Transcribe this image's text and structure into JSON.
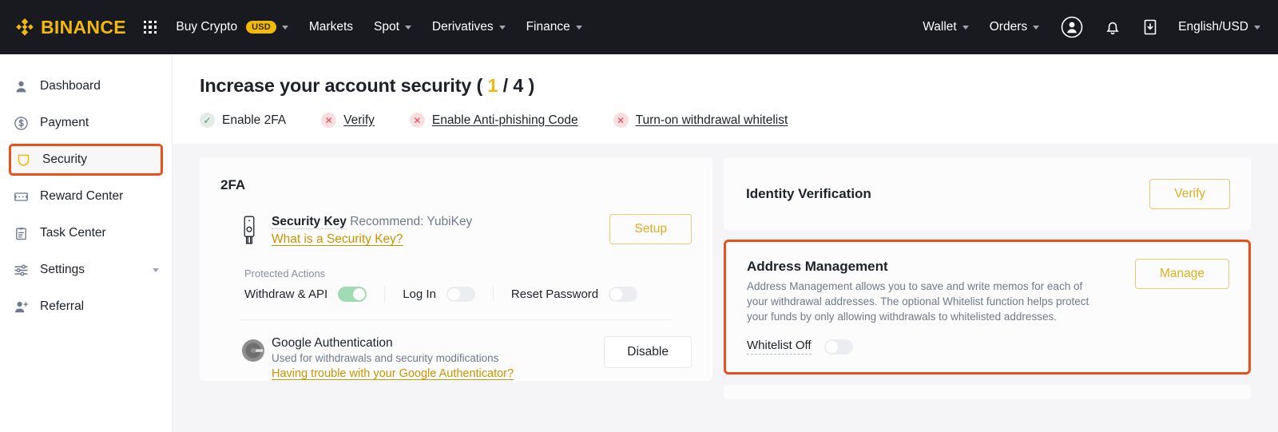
{
  "topnav": {
    "brand": "BINANCE",
    "apps_icon": "grid-apps-icon",
    "items": [
      {
        "label": "Buy Crypto",
        "badge": "USD",
        "caret": true
      },
      {
        "label": "Markets",
        "badge": null,
        "caret": false
      },
      {
        "label": "Spot",
        "badge": null,
        "caret": true
      },
      {
        "label": "Derivatives",
        "badge": null,
        "caret": true
      },
      {
        "label": "Finance",
        "badge": null,
        "caret": true
      }
    ],
    "right_items": [
      {
        "label": "Wallet",
        "caret": true
      },
      {
        "label": "Orders",
        "caret": true
      }
    ],
    "icons": [
      "user-account-icon",
      "notification-bell-icon",
      "download-app-icon"
    ],
    "locale": "English/USD"
  },
  "sidebar": {
    "items": [
      {
        "label": "Dashboard",
        "icon": "user-icon",
        "active": false,
        "caret": false
      },
      {
        "label": "Payment",
        "icon": "dollar-circle-icon",
        "active": false,
        "caret": false
      },
      {
        "label": "Security",
        "icon": "shield-icon",
        "active": true,
        "caret": false
      },
      {
        "label": "Reward Center",
        "icon": "ticket-icon",
        "active": false,
        "caret": false
      },
      {
        "label": "Task Center",
        "icon": "clipboard-icon",
        "active": false,
        "caret": false
      },
      {
        "label": "Settings",
        "icon": "sliders-icon",
        "active": false,
        "caret": true
      },
      {
        "label": "Referral",
        "icon": "user-plus-icon",
        "active": false,
        "caret": false
      }
    ]
  },
  "header": {
    "title_prefix": "Increase your account security ( ",
    "count": "1",
    "title_suffix": " / 4 )",
    "steps": [
      {
        "label": "Enable 2FA",
        "status": "done",
        "glyph": "✓",
        "link": false
      },
      {
        "label": "Verify",
        "status": "todo",
        "glyph": "✕",
        "link": true
      },
      {
        "label": "Enable Anti-phishing Code",
        "status": "todo",
        "glyph": "✕",
        "link": true
      },
      {
        "label": "Turn-on withdrawal whitelist",
        "status": "todo",
        "glyph": "✕",
        "link": true
      }
    ]
  },
  "twofa_card": {
    "title": "2FA",
    "security_key": {
      "icon": "security-key-icon",
      "name": "Security Key",
      "recommend": "Recommend: YubiKey",
      "link": "What is a Security Key?",
      "button": "Setup"
    },
    "protected_actions_label": "Protected Actions",
    "toggles": [
      {
        "label": "Withdraw & API",
        "state": "on"
      },
      {
        "label": "Log In",
        "state": "off"
      },
      {
        "label": "Reset Password",
        "state": "off"
      }
    ],
    "google_auth": {
      "icon": "google-authenticator-icon",
      "title": "Google Authentication",
      "subtitle": "Used for withdrawals and security modifications",
      "link": "Having trouble with your Google Authenticator?",
      "button": "Disable"
    }
  },
  "identity_card": {
    "title": "Identity Verification",
    "button": "Verify"
  },
  "address_card": {
    "title": "Address Management",
    "description": "Address Management allows you to save and write memos for each of your withdrawal addresses. The optional Whitelist function helps protect your funds by only allowing withdrawals to whitelisted addresses.",
    "button": "Manage",
    "whitelist_label": "Whitelist Off",
    "whitelist_state": "off"
  },
  "colors": {
    "brand_yellow": "#f0b90b",
    "nav_dark": "#181a20",
    "highlight_orange": "#e8511e",
    "toggle_on_green": "#9fdcb5",
    "link_gold": "#c99400",
    "page_bg": "#f5f5f7"
  }
}
